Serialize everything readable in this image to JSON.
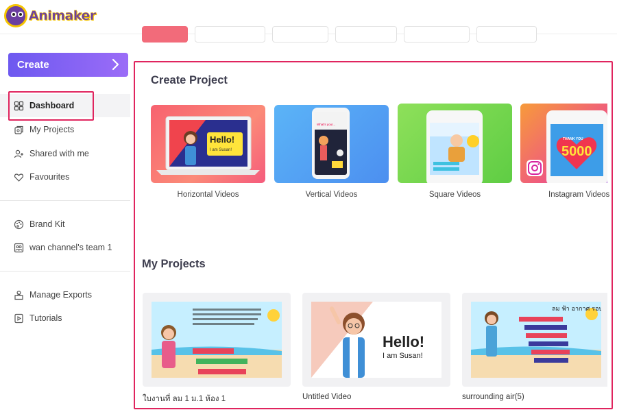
{
  "app": {
    "brand": "Animaker"
  },
  "sidebar": {
    "create_label": "Create",
    "items": [
      {
        "label": "Dashboard",
        "icon": "grid-icon",
        "active": true
      },
      {
        "label": "My Projects",
        "icon": "projects-icon"
      },
      {
        "label": "Shared with me",
        "icon": "user-plus-icon"
      },
      {
        "label": "Favourites",
        "icon": "heart-icon"
      },
      {
        "label": "Brand Kit",
        "icon": "palette-icon"
      },
      {
        "label": "wan channel's team 1",
        "icon": "team-icon"
      },
      {
        "label": "Manage Exports",
        "icon": "export-icon"
      },
      {
        "label": "Tutorials",
        "icon": "tutorials-icon"
      }
    ]
  },
  "create_project": {
    "title": "Create Project",
    "cards": [
      {
        "label": "Horizontal Videos",
        "thumb_text": "Hello!",
        "thumb_sub": "I am Susan!"
      },
      {
        "label": "Vertical Videos",
        "thumb_text": "What's your..."
      },
      {
        "label": "Square Videos"
      },
      {
        "label": "Instagram Videos",
        "thumb_text": "5000",
        "thumb_sub": "THANK YOU"
      }
    ]
  },
  "my_projects": {
    "title": "My Projects",
    "items": [
      {
        "label": "ใบงานที่ ลม 1 ม.1 ห้อง 1"
      },
      {
        "label": "Untitled Video",
        "thumb_text": "Hello!",
        "thumb_sub": "I am Susan!"
      },
      {
        "label": "surrounding air(5)",
        "thumb_text": "ลม ฟ้า อากาศ รอบตัว"
      }
    ]
  },
  "colors": {
    "accent": "#7b5cf3",
    "highlight": "#e0245e"
  }
}
